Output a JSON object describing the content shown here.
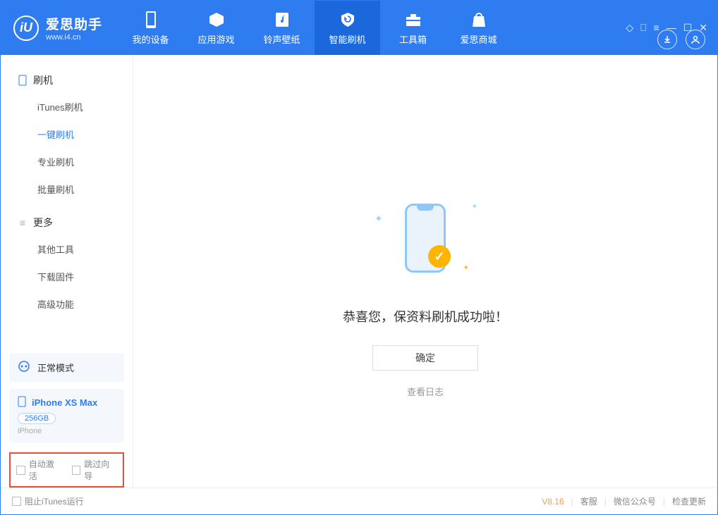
{
  "header": {
    "logo_letter": "iU",
    "logo_title": "爱思助手",
    "logo_sub": "www.i4.cn",
    "tabs": [
      {
        "label": "我的设备"
      },
      {
        "label": "应用游戏"
      },
      {
        "label": "铃声壁纸"
      },
      {
        "label": "智能刷机"
      },
      {
        "label": "工具箱"
      },
      {
        "label": "爱思商城"
      }
    ]
  },
  "sidebar": {
    "section1_title": "刷机",
    "items1": [
      "iTunes刷机",
      "一键刷机",
      "专业刷机",
      "批量刷机"
    ],
    "section2_title": "更多",
    "items2": [
      "其他工具",
      "下载固件",
      "高级功能"
    ],
    "mode_label": "正常模式",
    "device_name": "iPhone XS Max",
    "device_capacity": "256GB",
    "device_type": "iPhone",
    "chk1": "自动激活",
    "chk2": "跳过向导"
  },
  "main": {
    "success_text": "恭喜您，保资料刷机成功啦！",
    "ok_button": "确定",
    "log_link": "查看日志"
  },
  "statusbar": {
    "block_itunes": "阻止iTunes运行",
    "version": "V8.16",
    "support": "客服",
    "wechat": "微信公众号",
    "update": "检查更新"
  }
}
